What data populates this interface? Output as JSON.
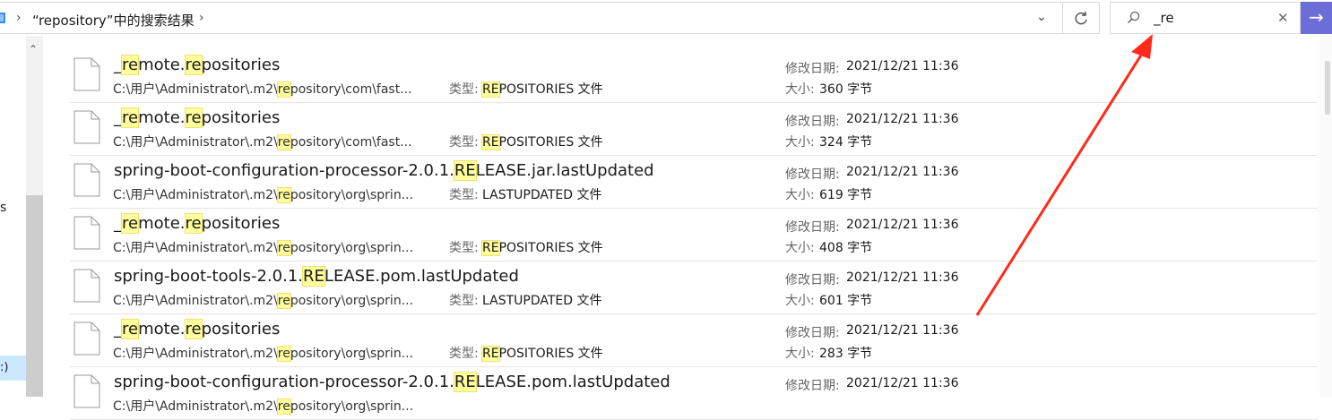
{
  "address_bar": {
    "path_text": "“repository”中的搜索结果",
    "chevron_icon": "chevron-right-icon",
    "dropdown_icon": "chevron-down-icon"
  },
  "refresh_icon": "refresh-icon",
  "search": {
    "value": "_re",
    "icon": "search-icon",
    "clear_icon": "close-icon",
    "go_icon": "arrow-right-icon",
    "go_color": "#6d6dd8"
  },
  "nav": {
    "partial_label": "s",
    "drive_label": ":)"
  },
  "labels": {
    "type": "类型:",
    "modified": "修改日期:",
    "size": "大小:"
  },
  "highlight_color": "#ffff9c",
  "results": [
    {
      "name": "_remote.repositories",
      "path": "C:\\用户\\Administrator\\.m2\\repository\\com\\fast...",
      "type": "REPOSITORIES 文件",
      "date": "2021/12/21 11:36",
      "size": "360 字节"
    },
    {
      "name": "_remote.repositories",
      "path": "C:\\用户\\Administrator\\.m2\\repository\\com\\fast...",
      "type": "REPOSITORIES 文件",
      "date": "2021/12/21 11:36",
      "size": "324 字节"
    },
    {
      "name": "spring-boot-configuration-processor-2.0.1.RELEASE.jar.lastUpdated",
      "path": "C:\\用户\\Administrator\\.m2\\repository\\org\\sprin...",
      "type": "LASTUPDATED 文件",
      "date": "2021/12/21 11:36",
      "size": "619 字节"
    },
    {
      "name": "_remote.repositories",
      "path": "C:\\用户\\Administrator\\.m2\\repository\\org\\sprin...",
      "type": "REPOSITORIES 文件",
      "date": "2021/12/21 11:36",
      "size": "408 字节"
    },
    {
      "name": "spring-boot-tools-2.0.1.RELEASE.pom.lastUpdated",
      "path": "C:\\用户\\Administrator\\.m2\\repository\\org\\sprin...",
      "type": "LASTUPDATED 文件",
      "date": "2021/12/21 11:36",
      "size": "601 字节"
    },
    {
      "name": "_remote.repositories",
      "path": "C:\\用户\\Administrator\\.m2\\repository\\org\\sprin...",
      "type": "REPOSITORIES 文件",
      "date": "2021/12/21 11:36",
      "size": "283 字节"
    },
    {
      "name": "spring-boot-configuration-processor-2.0.1.RELEASE.pom.lastUpdated",
      "path": "C:\\用户\\Administrator\\.m2\\repository\\org\\sprin...",
      "type": "",
      "date": "2021/12/21 11:36",
      "size": ""
    }
  ],
  "annotation": {
    "color": "#ff2a1a",
    "icon": "red-arrow-annotation"
  }
}
